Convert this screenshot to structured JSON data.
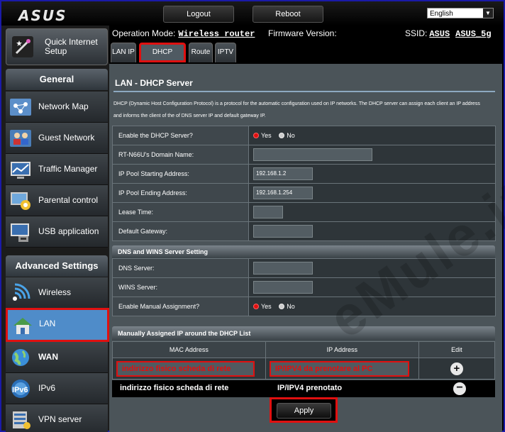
{
  "brand": "ASUS",
  "topbar": {
    "logout": "Logout",
    "reboot": "Reboot",
    "language": "English"
  },
  "sidebar": {
    "quick_setup": "Quick Internet Setup",
    "general_title": "General",
    "general_items": [
      {
        "label": "Network Map",
        "icon": "network-map-icon"
      },
      {
        "label": "Guest Network",
        "icon": "guest-network-icon"
      },
      {
        "label": "Traffic Manager",
        "icon": "traffic-manager-icon"
      },
      {
        "label": "Parental control",
        "icon": "parental-control-icon"
      },
      {
        "label": "USB application",
        "icon": "usb-application-icon"
      }
    ],
    "advanced_title": "Advanced Settings",
    "advanced_items": [
      {
        "label": "Wireless",
        "icon": "wireless-icon"
      },
      {
        "label": "LAN",
        "icon": "lan-icon",
        "active": true
      },
      {
        "label": "WAN",
        "icon": "wan-icon"
      },
      {
        "label": "IPv6",
        "icon": "ipv6-icon"
      },
      {
        "label": "VPN server",
        "icon": "vpn-server-icon"
      }
    ]
  },
  "header": {
    "op_mode_label": "Operation Mode:",
    "op_mode_value": "Wireless router",
    "firmware_label": "Firmware Version:",
    "ssid_label": "SSID:",
    "ssid_1": "ASUS",
    "ssid_2": "ASUS_5g"
  },
  "tabs": [
    "LAN IP",
    "DHCP Server",
    "Route",
    "IPTV"
  ],
  "panel": {
    "title": "LAN - DHCP Server",
    "description": "DHCP (Dynamic Host Configuration Protocol) is a protocol for the automatic configuration used on IP networks. The DHCP server can assign each client an IP address and informs the client of the of DNS server IP and default gateway IP.",
    "yes": "Yes",
    "no": "No",
    "fields": {
      "enable_dhcp": "Enable the DHCP Server?",
      "domain_name": "RT-N66U's Domain Name:",
      "pool_start": "IP Pool Starting Address:",
      "pool_start_value": "192.168.1.2",
      "pool_end": "IP Pool Ending Address:",
      "pool_end_value": "192.168.1.254",
      "lease_time": "Lease Time:",
      "default_gateway": "Default Gateway:"
    },
    "dns_section": {
      "title": "DNS and WINS Server Setting",
      "dns_server": "DNS Server:",
      "wins_server": "WINS Server:",
      "manual_assignment": "Enable Manual Assignment?"
    },
    "manual_list": {
      "title": "Manually Assigned IP around the DHCP List",
      "col_mac": "MAC Address",
      "col_ip": "IP Address",
      "col_edit": "Edit",
      "input_mac": "indirizzo fisico scheda di rete",
      "input_ip": "IP/IPV4 da prenotare al PC",
      "row_mac": "indirizzo fisico scheda di rete",
      "row_ip": "IP/IPV4 prenotato"
    },
    "apply": "Apply"
  },
  "watermark": "eMule.it",
  "colors": {
    "highlight": "#e01010",
    "active_menu": "#4f8cc9",
    "panel_bg": "#4b5459"
  }
}
